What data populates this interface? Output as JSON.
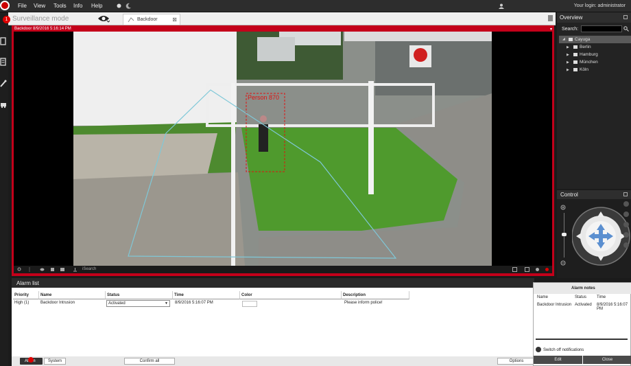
{
  "menubar": {
    "items": [
      "File",
      "View",
      "Tools",
      "Info",
      "Help"
    ],
    "login_text": "Your login: administrator"
  },
  "mode": {
    "title": "Surveillance mode",
    "badge_count": "1",
    "tab_label": "Backdoor"
  },
  "camera": {
    "header": "Backdoor 8/9/2016 5:16:14 PM",
    "overlay_label": "Person 870",
    "toolbar_search": "iSearch"
  },
  "alarm_list": {
    "title": "Alarm list",
    "columns": [
      "Priority",
      "Name",
      "Status",
      "Time",
      "Color",
      "Description"
    ],
    "rows": [
      {
        "priority": "High (1)",
        "name": "Backdoor Intrusion",
        "status": "Activated",
        "time": "8/9/2016 5:16:07 PM",
        "description": "Please inform police!"
      }
    ],
    "footer": {
      "alarm_tab": "Alarm",
      "system_tab": "System",
      "confirm_all": "Confirm all",
      "options": "Options"
    }
  },
  "overview": {
    "title": "Overview",
    "search_label": "Search:",
    "search_value": "",
    "root": "Cayuga",
    "children": [
      "Berlin",
      "Hamburg",
      "München",
      "Köln"
    ]
  },
  "control": {
    "title": "Control"
  },
  "alarm_notes": {
    "title": "Alarm notes",
    "columns": [
      "Name",
      "Status",
      "Time"
    ],
    "row": {
      "name": "Backdoor Intrusion",
      "status": "Activated",
      "time": "8/9/2016 5:16:07 PM"
    },
    "switch_off": "Switch off notifications",
    "edit": "Edit",
    "close": "Close"
  },
  "colors": {
    "alarm_red": "#c4001a",
    "badge_red": "#dd0000",
    "ptz_blue": "#5b8fd0"
  },
  "icons": [
    "eye-icon",
    "user-icon",
    "search-icon",
    "home-icon",
    "zoom-in-icon",
    "zoom-out-icon",
    "arrow-up-icon",
    "arrow-down-icon",
    "arrow-left-icon",
    "arrow-right-icon"
  ]
}
